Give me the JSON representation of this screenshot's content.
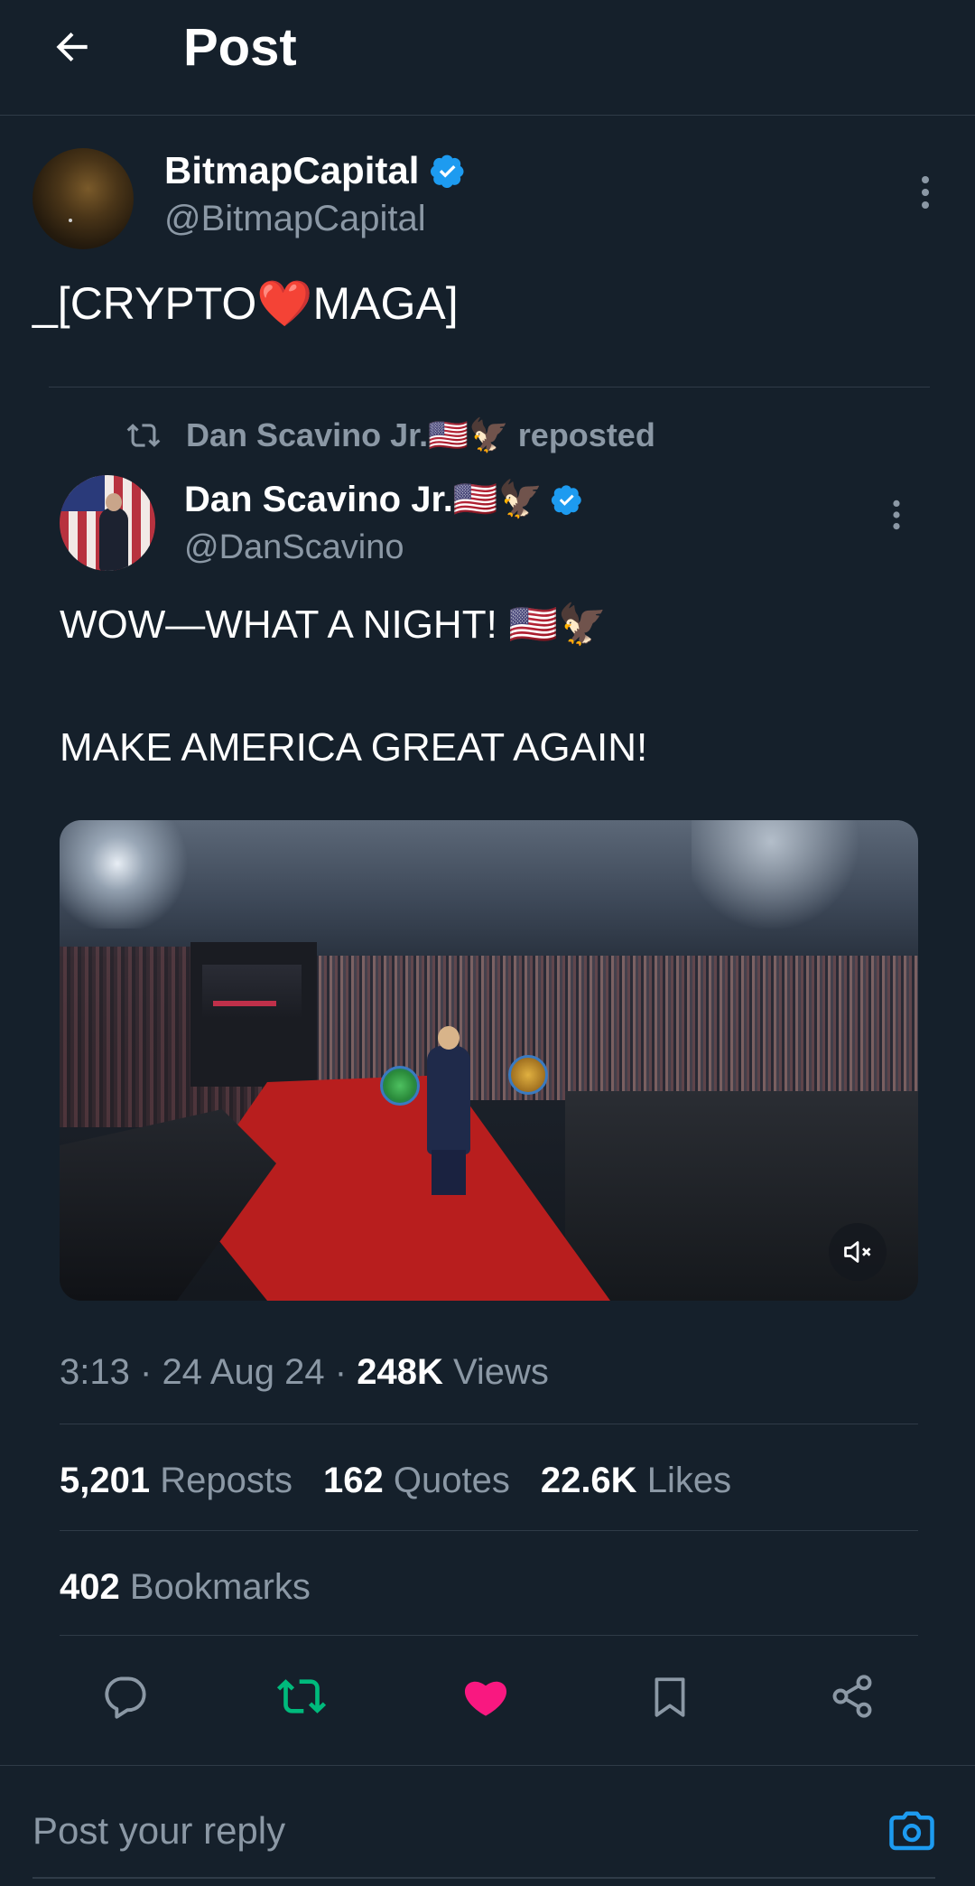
{
  "header": {
    "title": "Post"
  },
  "post": {
    "author_name": "BitmapCapital",
    "author_handle": "@BitmapCapital",
    "text_before": "_[CRYPTO",
    "text_emoji": "❤️",
    "text_after": "MAGA]"
  },
  "quoted": {
    "repost_by": "Dan Scavino Jr.🇺🇸🦅",
    "repost_suffix": "reposted",
    "author_name": "Dan Scavino Jr.🇺🇸🦅",
    "author_handle": "@DanScavino",
    "line1": "WOW—WHAT A NIGHT! 🇺🇸🦅",
    "line2": "MAKE AMERICA GREAT AGAIN!"
  },
  "meta": {
    "time": "3:13",
    "date": "24 Aug 24",
    "views_count": "248K",
    "views_label": "Views",
    "sep": "·"
  },
  "stats": {
    "reposts_count": "5,201",
    "reposts_label": "Reposts",
    "quotes_count": "162",
    "quotes_label": "Quotes",
    "likes_count": "22.6K",
    "likes_label": "Likes",
    "bookmarks_count": "402",
    "bookmarks_label": "Bookmarks"
  },
  "reply": {
    "placeholder": "Post your reply"
  },
  "colors": {
    "background": "#15202b",
    "accent": "#1d9bf0",
    "repost_green": "#00ba7c",
    "like_pink": "#f91880",
    "muted": "#8b98a5"
  },
  "icons": [
    "back-arrow-icon",
    "verified-badge-icon",
    "more-vertical-icon",
    "repost-icon",
    "mute-icon",
    "reply-icon",
    "like-icon",
    "bookmark-icon",
    "share-icon",
    "camera-icon"
  ]
}
